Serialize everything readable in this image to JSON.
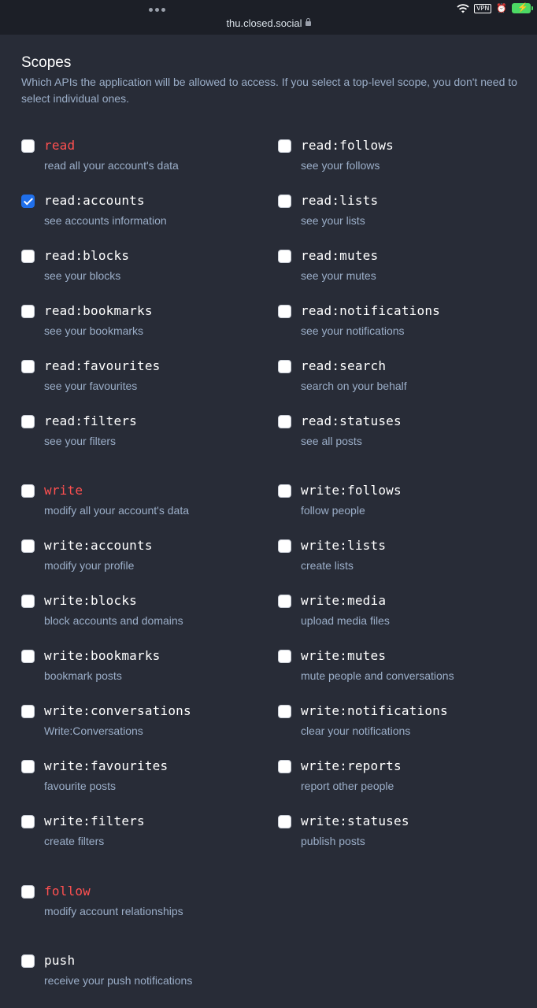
{
  "browser": {
    "url": "thu.closed.social",
    "vpn_label": "VPN"
  },
  "heading": {
    "title": "Scopes",
    "description": "Which APIs the application will be allowed to access. If you select a top-level scope, you don't need to select individual ones."
  },
  "scopes": [
    {
      "name": "read",
      "desc": "read all your account's data",
      "checked": false,
      "danger": true
    },
    {
      "name": "read:follows",
      "desc": "see your follows",
      "checked": false,
      "danger": false
    },
    {
      "name": "read:accounts",
      "desc": "see accounts information",
      "checked": true,
      "danger": false
    },
    {
      "name": "read:lists",
      "desc": "see your lists",
      "checked": false,
      "danger": false
    },
    {
      "name": "read:blocks",
      "desc": "see your blocks",
      "checked": false,
      "danger": false
    },
    {
      "name": "read:mutes",
      "desc": "see your mutes",
      "checked": false,
      "danger": false
    },
    {
      "name": "read:bookmarks",
      "desc": "see your bookmarks",
      "checked": false,
      "danger": false
    },
    {
      "name": "read:notifications",
      "desc": "see your notifications",
      "checked": false,
      "danger": false
    },
    {
      "name": "read:favourites",
      "desc": "see your favourites",
      "checked": false,
      "danger": false
    },
    {
      "name": "read:search",
      "desc": "search on your behalf",
      "checked": false,
      "danger": false
    },
    {
      "name": "read:filters",
      "desc": "see your filters",
      "checked": false,
      "danger": false
    },
    {
      "name": "read:statuses",
      "desc": "see all posts",
      "checked": false,
      "danger": false
    },
    {
      "name": "write",
      "desc": "modify all your account's data",
      "checked": false,
      "danger": true
    },
    {
      "name": "write:follows",
      "desc": "follow people",
      "checked": false,
      "danger": false
    },
    {
      "name": "write:accounts",
      "desc": "modify your profile",
      "checked": false,
      "danger": false
    },
    {
      "name": "write:lists",
      "desc": "create lists",
      "checked": false,
      "danger": false
    },
    {
      "name": "write:blocks",
      "desc": "block accounts and domains",
      "checked": false,
      "danger": false
    },
    {
      "name": "write:media",
      "desc": "upload media files",
      "checked": false,
      "danger": false
    },
    {
      "name": "write:bookmarks",
      "desc": "bookmark posts",
      "checked": false,
      "danger": false
    },
    {
      "name": "write:mutes",
      "desc": "mute people and conversations",
      "checked": false,
      "danger": false
    },
    {
      "name": "write:conversations",
      "desc": "Write:Conversations",
      "checked": false,
      "danger": false
    },
    {
      "name": "write:notifications",
      "desc": "clear your notifications",
      "checked": false,
      "danger": false
    },
    {
      "name": "write:favourites",
      "desc": "favourite posts",
      "checked": false,
      "danger": false
    },
    {
      "name": "write:reports",
      "desc": "report other people",
      "checked": false,
      "danger": false
    },
    {
      "name": "write:filters",
      "desc": "create filters",
      "checked": false,
      "danger": false
    },
    {
      "name": "write:statuses",
      "desc": "publish posts",
      "checked": false,
      "danger": false
    },
    {
      "name": "follow",
      "desc": "modify account relationships",
      "checked": false,
      "danger": true
    },
    {
      "name": "push",
      "desc": "receive your push notifications",
      "checked": false,
      "danger": false
    }
  ],
  "colors": {
    "background": "#282c37",
    "danger": "#ff5050",
    "checkbox_checked": "#1f6feb",
    "muted_text": "#9baec8"
  }
}
